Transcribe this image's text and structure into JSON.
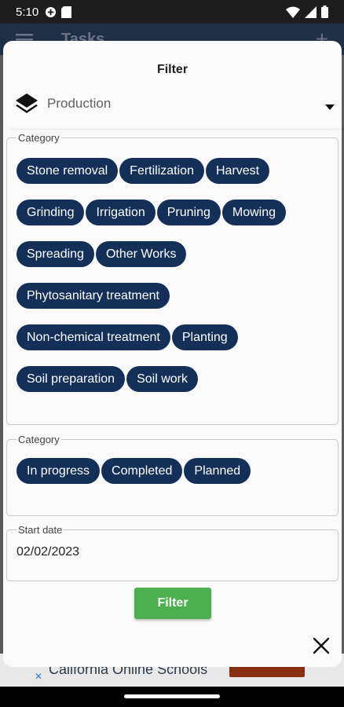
{
  "status": {
    "time": "5:10"
  },
  "appbar": {
    "title": "Tasks"
  },
  "dialog": {
    "title": "Filter",
    "production_select": {
      "value": "Production"
    },
    "category_group": {
      "legend": "Category",
      "chips": [
        "Stone removal",
        "Fertilization",
        "Harvest",
        "Grinding",
        "Irrigation",
        "Pruning",
        "Mowing",
        "Spreading",
        "Other Works",
        "Phytosanitary treatment",
        "Non-chemical treatment",
        "Planting",
        "Soil preparation",
        "Soil work"
      ]
    },
    "status_group": {
      "legend": "Category",
      "chips": [
        "In progress",
        "Completed",
        "Planned"
      ]
    },
    "start_date": {
      "legend": "Start date",
      "value": "02/02/2023"
    },
    "filter_button": "Filter"
  },
  "ad": {
    "text": "California Online Schools"
  },
  "colors": {
    "chip_bg": "#143058",
    "filter_button": "#4caf50",
    "appbar": "#1f2f45"
  }
}
